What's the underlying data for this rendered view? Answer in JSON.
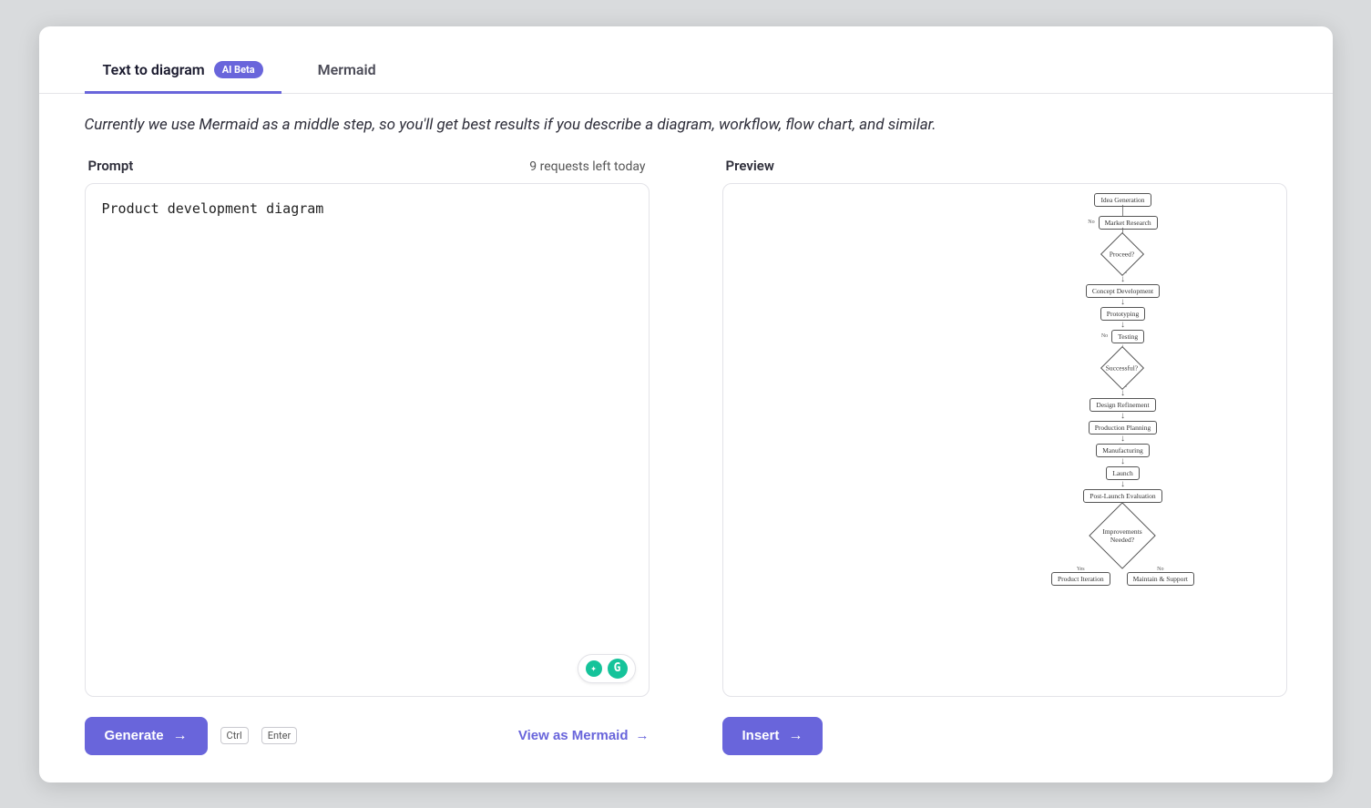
{
  "tabs": {
    "text_to_diagram": "Text to diagram",
    "badge": "AI Beta",
    "mermaid": "Mermaid"
  },
  "hint": "Currently we use Mermaid as a middle step, so you'll get best results if you describe a diagram, workflow, flow chart, and similar.",
  "prompt": {
    "label": "Prompt",
    "requests": "9 requests left today",
    "value": "Product development diagram"
  },
  "preview": {
    "label": "Preview",
    "nodes": {
      "idea": "Idea Generation",
      "research": "Market Research",
      "proceed": "Proceed?",
      "concept": "Concept Development",
      "proto": "Prototyping",
      "testing": "Testing",
      "success": "Successful?",
      "refine": "Design Refinement",
      "planning": "Production Planning",
      "manufacturing": "Manufacturing",
      "launch": "Launch",
      "postlaunch": "Post-Launch Evaluation",
      "improve": "Improvements Needed?",
      "iteration": "Product Iteration",
      "maintain": "Maintain & Support",
      "yes": "Yes",
      "no": "No"
    }
  },
  "buttons": {
    "generate": "Generate",
    "view_mermaid": "View as Mermaid",
    "insert": "Insert",
    "ctrl": "Ctrl",
    "enter": "Enter"
  }
}
